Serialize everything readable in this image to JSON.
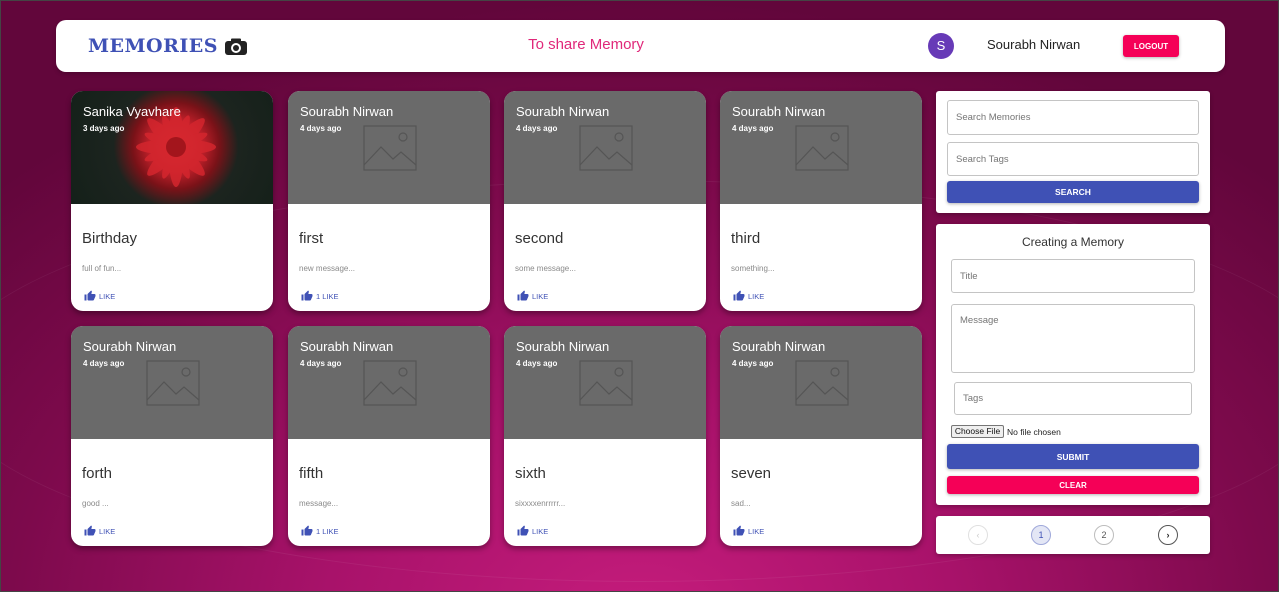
{
  "header": {
    "brand": "MEMORIES",
    "share_link": "To share Memory",
    "avatar_initial": "S",
    "user_name": "Sourabh Nirwan",
    "logout_label": "LOGOUT"
  },
  "posts": [
    {
      "author": "Sanika Vyavhare",
      "time": "3 days ago",
      "title": "Birthday",
      "message": "full of fun...",
      "like": "LIKE",
      "image": "flower-photo"
    },
    {
      "author": "Sourabh Nirwan",
      "time": "4 days ago",
      "title": "first",
      "message": "new message...",
      "like": "1 LIKE",
      "image": "image-placeholder"
    },
    {
      "author": "Sourabh Nirwan",
      "time": "4 days ago",
      "title": "second",
      "message": "some message...",
      "like": "LIKE",
      "image": "image-placeholder"
    },
    {
      "author": "Sourabh Nirwan",
      "time": "4 days ago",
      "title": "third",
      "message": "something...",
      "like": "LIKE",
      "image": "image-placeholder"
    },
    {
      "author": "Sourabh Nirwan",
      "time": "4 days ago",
      "title": "forth",
      "message": "good ...",
      "like": "LIKE",
      "image": "image-placeholder"
    },
    {
      "author": "Sourabh Nirwan",
      "time": "4 days ago",
      "title": "fifth",
      "message": "message...",
      "like": "1 LIKE",
      "image": "image-placeholder"
    },
    {
      "author": "Sourabh Nirwan",
      "time": "4 days ago",
      "title": "sixth",
      "message": "sixxxxenrrrrr...",
      "like": "LIKE",
      "image": "image-placeholder"
    },
    {
      "author": "Sourabh Nirwan",
      "time": "4 days ago",
      "title": "seven",
      "message": "sad...",
      "like": "LIKE",
      "image": "image-placeholder"
    }
  ],
  "search": {
    "memories_placeholder": "Search Memories",
    "tags_placeholder": "Search Tags",
    "button": "SEARCH"
  },
  "form": {
    "heading": "Creating a Memory",
    "title_placeholder": "Title",
    "message_placeholder": "Message",
    "tags_placeholder": "Tags",
    "file_button": "Choose File",
    "file_status": "No file chosen",
    "submit": "SUBMIT",
    "clear": "CLEAR"
  },
  "pagination": {
    "prev": "‹",
    "pages": [
      "1",
      "2"
    ],
    "next": "›",
    "current": "1"
  },
  "colors": {
    "primary": "#3f51b5",
    "secondary": "#f50057",
    "background": "#a8126a"
  }
}
